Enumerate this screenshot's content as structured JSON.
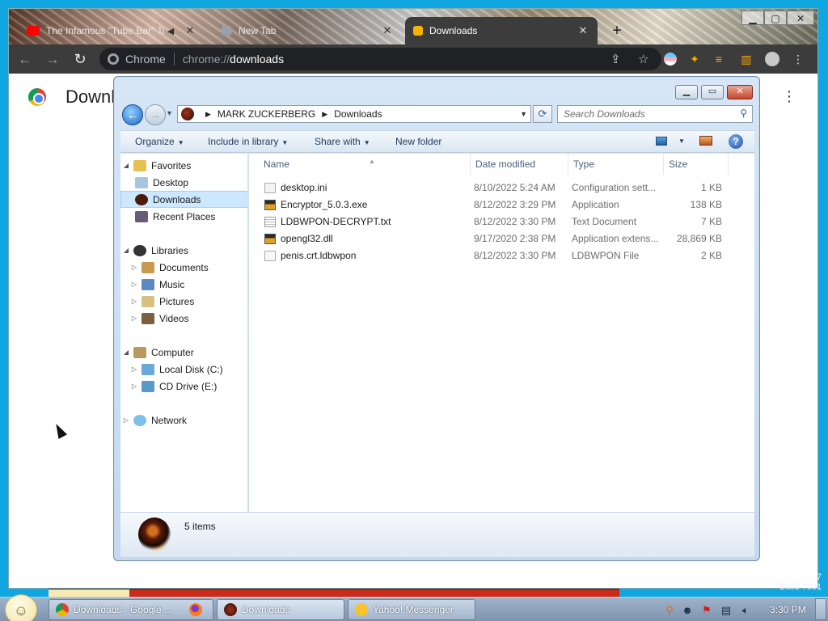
{
  "chrome": {
    "tabs": [
      {
        "label": "The Infamous \"Tube Bar\" Ta",
        "favicon_color": "#ff0000",
        "favicon": "youtube-icon"
      },
      {
        "label": "New Tab",
        "favicon_color": "#9aa0a6",
        "favicon": "chrome-icon"
      },
      {
        "label": "Downloads",
        "favicon_color": "#f4b400",
        "favicon": "download-icon"
      }
    ],
    "omnibox": {
      "site_chip": "Chrome",
      "url_scheme": "chrome://",
      "url_host": "downloads"
    },
    "page_heading": "Downl"
  },
  "explorer": {
    "breadcrumb": [
      "MARK ZUCKERBERG",
      "Downloads"
    ],
    "search_placeholder": "Search Downloads",
    "commands": {
      "organize": "Organize",
      "include_in_library": "Include in library",
      "share_with": "Share with",
      "new_folder": "New folder"
    },
    "nav": {
      "favorites": "Favorites",
      "desktop": "Desktop",
      "downloads": "Downloads",
      "recent_places": "Recent Places",
      "libraries": "Libraries",
      "documents": "Documents",
      "music": "Music",
      "pictures": "Pictures",
      "videos": "Videos",
      "computer": "Computer",
      "local_disk": "Local Disk (C:)",
      "cd_drive": "CD Drive (E:)",
      "network": "Network"
    },
    "columns": {
      "name": "Name",
      "date": "Date modified",
      "type": "Type",
      "size": "Size"
    },
    "files": [
      {
        "name": "desktop.ini",
        "date": "8/10/2022 5:24 AM",
        "type": "Configuration sett...",
        "size": "1 KB"
      },
      {
        "name": "Encryptor_5.0.3.exe",
        "date": "8/12/2022 3:29 PM",
        "type": "Application",
        "size": "138 KB"
      },
      {
        "name": "LDBWPON-DECRYPT.txt",
        "date": "8/12/2022 3:30 PM",
        "type": "Text Document",
        "size": "7 KB"
      },
      {
        "name": "opengl32.dll",
        "date": "9/17/2020 2:38 PM",
        "type": "Application extens...",
        "size": "28,869 KB"
      },
      {
        "name": "penis.crt.ldbwpon",
        "date": "8/12/2022 3:30 PM",
        "type": "LDBWPON File",
        "size": "2 KB"
      }
    ],
    "item_count": "5 items"
  },
  "taskbar": {
    "buttons": [
      {
        "label": "Downloads - Google ..."
      },
      {
        "label": ""
      },
      {
        "label": "Downloads"
      },
      {
        "label": "Yahoo! Messenger"
      }
    ],
    "clock": "3:30 PM",
    "build_text": "Build 7601",
    "build_digit": "7"
  }
}
